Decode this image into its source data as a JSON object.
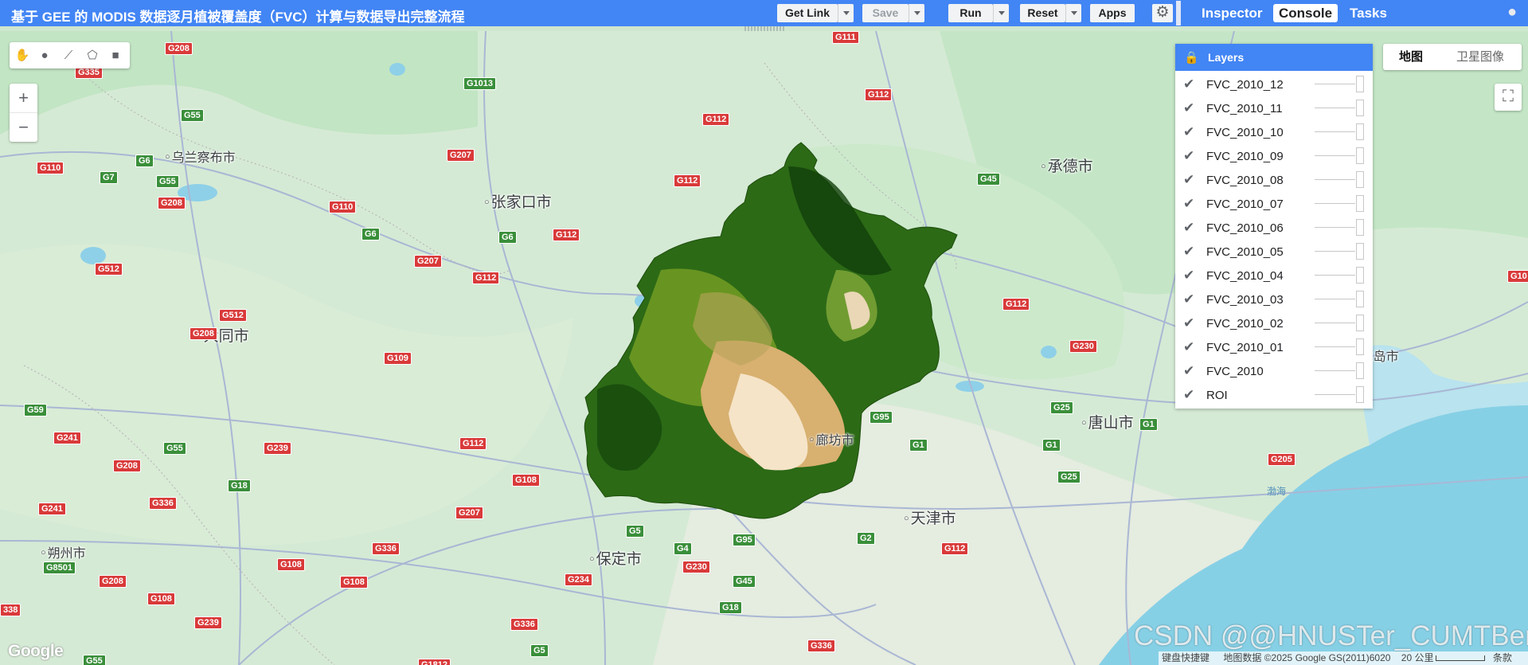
{
  "toolbar": {
    "title": "基于 GEE 的 MODIS 数据逐月植被覆盖度（FVC）计算与数据导出完整流程",
    "get_link": "Get Link",
    "save": "Save",
    "run": "Run",
    "reset": "Reset",
    "apps": "Apps"
  },
  "tabs": {
    "inspector": "Inspector",
    "console": "Console",
    "tasks": "Tasks"
  },
  "map_type": {
    "map": "地图",
    "satellite": "卫星图像"
  },
  "layers": {
    "title": "Layers",
    "items": [
      "FVC_2010_12",
      "FVC_2010_11",
      "FVC_2010_10",
      "FVC_2010_09",
      "FVC_2010_08",
      "FVC_2010_07",
      "FVC_2010_06",
      "FVC_2010_05",
      "FVC_2010_04",
      "FVC_2010_03",
      "FVC_2010_02",
      "FVC_2010_01",
      "FVC_2010",
      "ROI"
    ]
  },
  "cities": {
    "ulanqab": "乌兰察布市",
    "zhangjiakou": "张家口市",
    "chengde": "承德市",
    "datong": "大同市",
    "langfang": "廊坊市",
    "tangshan": "唐山市",
    "shuozhou": "朔州市",
    "tianjin": "天津市",
    "baoding": "保定市",
    "qinhuangdao": "秦皇岛市"
  },
  "sea_label": "渤海",
  "attribution": {
    "shortcuts": "键盘快捷键",
    "data": "地图数据 ©2025 Google GS(2011)6020",
    "scale": "20 公里",
    "terms": "条款"
  },
  "google_logo": "Google",
  "watermark": "CSDN @@HNUSTer_CUMTBer",
  "colors": {
    "accent": "#4285f4",
    "fvc_high": "#1b5e10",
    "fvc_low": "#f2c58a"
  }
}
